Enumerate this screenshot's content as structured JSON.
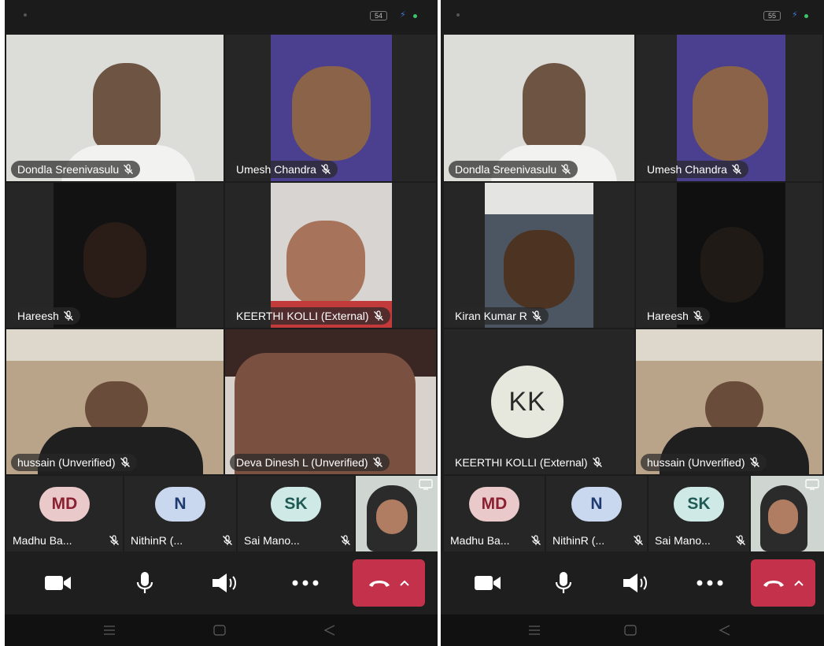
{
  "left": {
    "status": {
      "battery": "54"
    },
    "tiles": [
      {
        "name": "Dondla Sreenivasulu",
        "bg": "#d9d9d5"
      },
      {
        "name": "Umesh Chandra",
        "bg": "#5a3fa8"
      },
      {
        "name": "Hareesh",
        "bg": "#141414"
      },
      {
        "name": "KEERTHI KOLLI (External)",
        "bg": "#c9a891"
      },
      {
        "name": "hussain (Unverified)",
        "bg": "#8c7a62"
      },
      {
        "name": "Deva Dinesh L (Unverified)",
        "bg": "#6b4b42"
      }
    ],
    "strip": [
      {
        "initials": "MD",
        "label": "Madhu Ba...",
        "avatar_bg": "#e9c9c9",
        "avatar_fg": "#8a2030"
      },
      {
        "initials": "N",
        "label": "NithinR (...",
        "avatar_bg": "#c9d8ef",
        "avatar_fg": "#1e3a6e"
      },
      {
        "initials": "SK",
        "label": "Sai Mano...",
        "avatar_bg": "#cfe9e6",
        "avatar_fg": "#1f5a55"
      }
    ]
  },
  "right": {
    "status": {
      "battery": "55"
    },
    "tiles": [
      {
        "name": "Dondla Sreenivasulu",
        "bg": "#d9d9d5"
      },
      {
        "name": "Umesh Chandra",
        "bg": "#5a3fa8"
      },
      {
        "name": "Kiran Kumar R",
        "bg": "#4a5a6e"
      },
      {
        "name": "Hareesh",
        "bg": "#141414"
      },
      {
        "name": "KEERTHI KOLLI (External)",
        "initials": "KK"
      },
      {
        "name": "hussain (Unverified)",
        "bg": "#8c7a62"
      }
    ],
    "strip": [
      {
        "initials": "MD",
        "label": "Madhu Ba...",
        "avatar_bg": "#e9c9c9",
        "avatar_fg": "#8a2030"
      },
      {
        "initials": "N",
        "label": "NithinR (...",
        "avatar_bg": "#c9d8ef",
        "avatar_fg": "#1e3a6e"
      },
      {
        "initials": "SK",
        "label": "Sai Mano...",
        "avatar_bg": "#cfe9e6",
        "avatar_fg": "#1f5a55"
      }
    ]
  },
  "colors": {
    "hangup": "#c4314b",
    "battery_bolt": "#3f7bd9",
    "status_dot": "#3cc46a"
  },
  "icons": [
    "camera-icon",
    "microphone-icon",
    "speaker-icon",
    "more-options-icon",
    "hang-up-icon",
    "chevron-up-icon",
    "mic-muted-icon",
    "screen-share-icon",
    "nav-recents-icon",
    "nav-home-icon",
    "nav-back-icon"
  ]
}
